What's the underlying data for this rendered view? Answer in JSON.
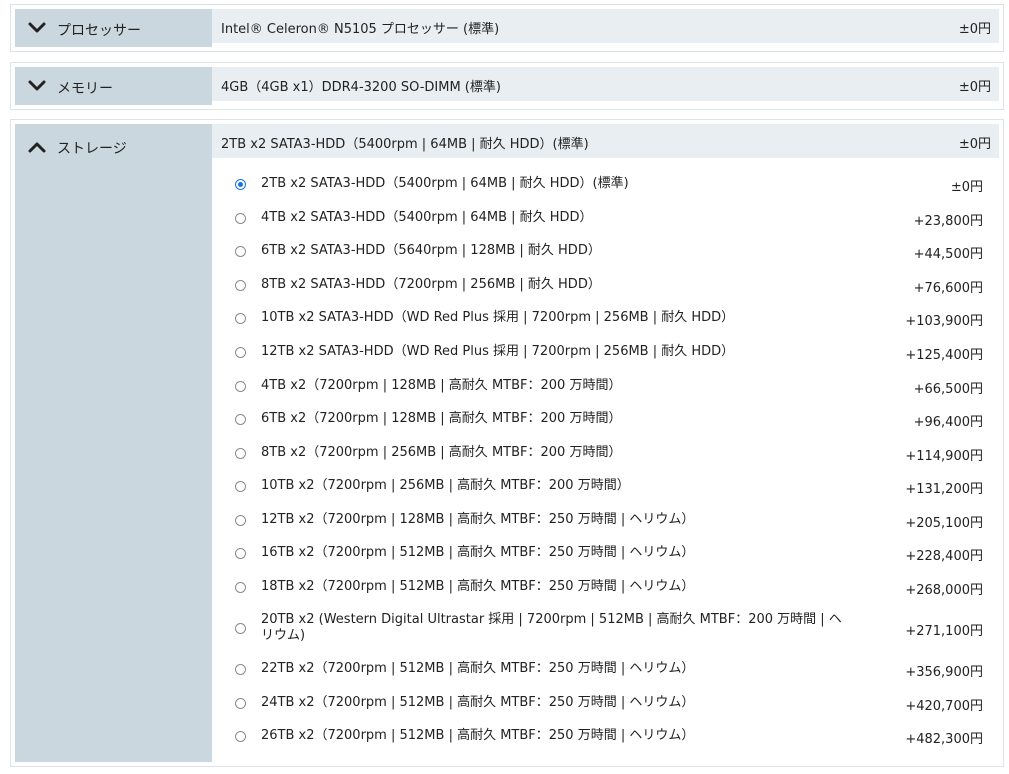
{
  "sections": [
    {
      "title": "プロセッサー",
      "expanded": false,
      "chevron": "chevron-down-icon",
      "selected": "Intel® Celeron® N5105 プロセッサー (標準)",
      "price": "±0円"
    },
    {
      "title": "メモリー",
      "expanded": false,
      "chevron": "chevron-down-icon",
      "selected": "4GB（4GB x1）DDR4-3200 SO-DIMM (標準)",
      "price": "±0円"
    },
    {
      "title": "ストレージ",
      "expanded": true,
      "chevron": "chevron-up-icon",
      "selected": "2TB x2 SATA3-HDD（5400rpm | 64MB | 耐久 HDD）(標準)",
      "price": "±0円"
    }
  ],
  "storage_options": [
    {
      "label": "2TB x2 SATA3-HDD（5400rpm | 64MB | 耐久 HDD）(標準)",
      "price": "±0円",
      "checked": true
    },
    {
      "label": "4TB x2 SATA3-HDD（5400rpm | 64MB | 耐久 HDD）",
      "price": "+23,800円",
      "checked": false
    },
    {
      "label": "6TB x2 SATA3-HDD（5640rpm | 128MB | 耐久 HDD）",
      "price": "+44,500円",
      "checked": false
    },
    {
      "label": "8TB x2 SATA3-HDD（7200rpm | 256MB | 耐久 HDD）",
      "price": "+76,600円",
      "checked": false
    },
    {
      "label": "10TB x2 SATA3-HDD（WD Red Plus 採用 | 7200rpm | 256MB | 耐久 HDD）",
      "price": "+103,900円",
      "checked": false
    },
    {
      "label": "12TB x2 SATA3-HDD（WD Red Plus 採用 | 7200rpm | 256MB | 耐久 HDD）",
      "price": "+125,400円",
      "checked": false
    },
    {
      "label": "4TB x2（7200rpm | 128MB | 高耐久 MTBF：200 万時間）",
      "price": "+66,500円",
      "checked": false
    },
    {
      "label": "6TB x2（7200rpm | 128MB | 高耐久 MTBF：200 万時間）",
      "price": "+96,400円",
      "checked": false
    },
    {
      "label": "8TB x2（7200rpm | 256MB | 高耐久 MTBF：200 万時間）",
      "price": "+114,900円",
      "checked": false
    },
    {
      "label": "10TB x2（7200rpm | 256MB | 高耐久 MTBF：200 万時間）",
      "price": "+131,200円",
      "checked": false
    },
    {
      "label": "12TB x2（7200rpm | 128MB | 高耐久 MTBF：250 万時間 | ヘリウム）",
      "price": "+205,100円",
      "checked": false
    },
    {
      "label": "16TB x2（7200rpm | 512MB | 高耐久 MTBF：250 万時間 | ヘリウム）",
      "price": "+228,400円",
      "checked": false
    },
    {
      "label": "18TB x2（7200rpm | 512MB | 高耐久 MTBF：250 万時間 | ヘリウム）",
      "price": "+268,000円",
      "checked": false
    },
    {
      "label": "20TB x2 (Western Digital Ultrastar 採用 | 7200rpm | 512MB | 高耐久 MTBF：200 万時間 | ヘリウム)",
      "price": "+271,100円",
      "checked": false
    },
    {
      "label": "22TB x2（7200rpm | 512MB | 高耐久 MTBF：250 万時間 | ヘリウム）",
      "price": "+356,900円",
      "checked": false
    },
    {
      "label": "24TB x2（7200rpm | 512MB | 高耐久 MTBF：250 万時間 | ヘリウム）",
      "price": "+420,700円",
      "checked": false
    },
    {
      "label": "26TB x2（7200rpm | 512MB | 高耐久 MTBF：250 万時間 | ヘリウム）",
      "price": "+482,300円",
      "checked": false
    }
  ],
  "colors": {
    "header_bg": "#cbd7df",
    "selected_bg": "#e9eef2",
    "border": "#dde3e8",
    "radio_accent": "#1a73e8"
  }
}
